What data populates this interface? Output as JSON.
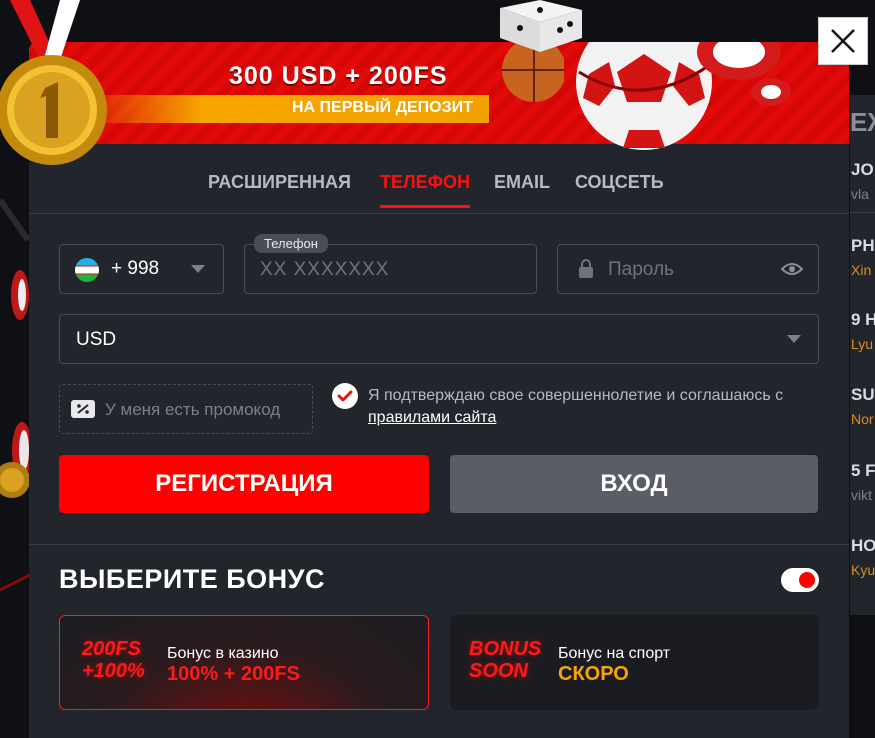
{
  "background": {
    "heading_partial": "ЕЖ",
    "items": [
      {
        "title": "JO",
        "subtitle": "vla",
        "subtitle_color": "gray"
      },
      {
        "title": "PH",
        "subtitle": "Xin",
        "subtitle_color": "orange"
      },
      {
        "title": "9 H",
        "subtitle": "Lyu",
        "subtitle_color": "orange"
      },
      {
        "title": "SU",
        "subtitle": "Nor",
        "subtitle_color": "orange"
      },
      {
        "title": "5 F",
        "subtitle": "vikt",
        "subtitle_color": "gray"
      },
      {
        "title": "HO",
        "subtitle": "Kyu",
        "subtitle_color": "orange"
      }
    ]
  },
  "banner": {
    "title": "300 USD + 200FS",
    "subtitle": "НА ПЕРВЫЙ ДЕПОЗИТ"
  },
  "tabs": [
    {
      "label": "РАСШИРЕННАЯ",
      "active": false
    },
    {
      "label": "ТЕЛЕФОН",
      "active": true
    },
    {
      "label": "EMAIL",
      "active": false
    },
    {
      "label": "СОЦСЕТЬ",
      "active": false
    }
  ],
  "form": {
    "country_code": "+ 998",
    "phone_label": "Телефон",
    "phone_placeholder": "XX XXXXXXX",
    "password_placeholder": "Пароль",
    "currency": "USD",
    "promo_placeholder": "У меня есть промокод",
    "agree_text": "Я подтверждаю свое совершеннолетие и соглашаюсь с",
    "agree_link": "правилами сайта",
    "register_label": "РЕГИСТРАЦИЯ",
    "login_label": "ВХОД"
  },
  "bonus": {
    "title": "ВЫБЕРИТЕ БОНУС",
    "toggle_on": true,
    "cards": [
      {
        "logo_line1": "200FS",
        "logo_line2": "+100%",
        "label": "Бонус в казино",
        "value": "100% + 200FS",
        "value_color": "#ff1a1a",
        "selected": true
      },
      {
        "logo_line1": "BONUS",
        "logo_line2": "SOON",
        "label": "Бонус на спорт",
        "value": "СКОРО",
        "value_color": "#f7a500",
        "selected": false
      }
    ]
  },
  "colors": {
    "accent": "#ff0000",
    "panel": "#23252c",
    "gold": "#f7a500"
  }
}
